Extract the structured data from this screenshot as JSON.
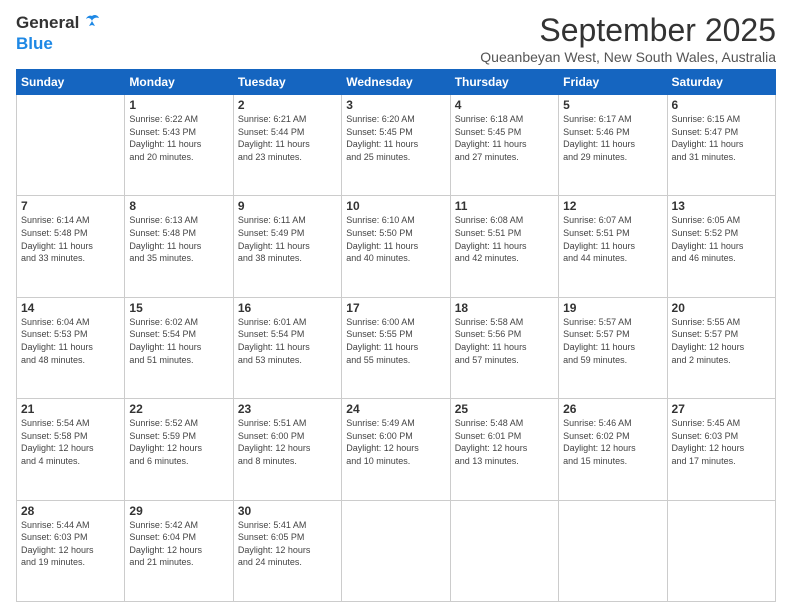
{
  "header": {
    "logo": {
      "general": "General",
      "blue": "Blue"
    },
    "title": "September 2025",
    "subtitle": "Queanbeyan West, New South Wales, Australia"
  },
  "days_of_week": [
    "Sunday",
    "Monday",
    "Tuesday",
    "Wednesday",
    "Thursday",
    "Friday",
    "Saturday"
  ],
  "weeks": [
    [
      {
        "day": "",
        "info": ""
      },
      {
        "day": "1",
        "info": "Sunrise: 6:22 AM\nSunset: 5:43 PM\nDaylight: 11 hours\nand 20 minutes."
      },
      {
        "day": "2",
        "info": "Sunrise: 6:21 AM\nSunset: 5:44 PM\nDaylight: 11 hours\nand 23 minutes."
      },
      {
        "day": "3",
        "info": "Sunrise: 6:20 AM\nSunset: 5:45 PM\nDaylight: 11 hours\nand 25 minutes."
      },
      {
        "day": "4",
        "info": "Sunrise: 6:18 AM\nSunset: 5:45 PM\nDaylight: 11 hours\nand 27 minutes."
      },
      {
        "day": "5",
        "info": "Sunrise: 6:17 AM\nSunset: 5:46 PM\nDaylight: 11 hours\nand 29 minutes."
      },
      {
        "day": "6",
        "info": "Sunrise: 6:15 AM\nSunset: 5:47 PM\nDaylight: 11 hours\nand 31 minutes."
      }
    ],
    [
      {
        "day": "7",
        "info": "Sunrise: 6:14 AM\nSunset: 5:48 PM\nDaylight: 11 hours\nand 33 minutes."
      },
      {
        "day": "8",
        "info": "Sunrise: 6:13 AM\nSunset: 5:48 PM\nDaylight: 11 hours\nand 35 minutes."
      },
      {
        "day": "9",
        "info": "Sunrise: 6:11 AM\nSunset: 5:49 PM\nDaylight: 11 hours\nand 38 minutes."
      },
      {
        "day": "10",
        "info": "Sunrise: 6:10 AM\nSunset: 5:50 PM\nDaylight: 11 hours\nand 40 minutes."
      },
      {
        "day": "11",
        "info": "Sunrise: 6:08 AM\nSunset: 5:51 PM\nDaylight: 11 hours\nand 42 minutes."
      },
      {
        "day": "12",
        "info": "Sunrise: 6:07 AM\nSunset: 5:51 PM\nDaylight: 11 hours\nand 44 minutes."
      },
      {
        "day": "13",
        "info": "Sunrise: 6:05 AM\nSunset: 5:52 PM\nDaylight: 11 hours\nand 46 minutes."
      }
    ],
    [
      {
        "day": "14",
        "info": "Sunrise: 6:04 AM\nSunset: 5:53 PM\nDaylight: 11 hours\nand 48 minutes."
      },
      {
        "day": "15",
        "info": "Sunrise: 6:02 AM\nSunset: 5:54 PM\nDaylight: 11 hours\nand 51 minutes."
      },
      {
        "day": "16",
        "info": "Sunrise: 6:01 AM\nSunset: 5:54 PM\nDaylight: 11 hours\nand 53 minutes."
      },
      {
        "day": "17",
        "info": "Sunrise: 6:00 AM\nSunset: 5:55 PM\nDaylight: 11 hours\nand 55 minutes."
      },
      {
        "day": "18",
        "info": "Sunrise: 5:58 AM\nSunset: 5:56 PM\nDaylight: 11 hours\nand 57 minutes."
      },
      {
        "day": "19",
        "info": "Sunrise: 5:57 AM\nSunset: 5:57 PM\nDaylight: 11 hours\nand 59 minutes."
      },
      {
        "day": "20",
        "info": "Sunrise: 5:55 AM\nSunset: 5:57 PM\nDaylight: 12 hours\nand 2 minutes."
      }
    ],
    [
      {
        "day": "21",
        "info": "Sunrise: 5:54 AM\nSunset: 5:58 PM\nDaylight: 12 hours\nand 4 minutes."
      },
      {
        "day": "22",
        "info": "Sunrise: 5:52 AM\nSunset: 5:59 PM\nDaylight: 12 hours\nand 6 minutes."
      },
      {
        "day": "23",
        "info": "Sunrise: 5:51 AM\nSunset: 6:00 PM\nDaylight: 12 hours\nand 8 minutes."
      },
      {
        "day": "24",
        "info": "Sunrise: 5:49 AM\nSunset: 6:00 PM\nDaylight: 12 hours\nand 10 minutes."
      },
      {
        "day": "25",
        "info": "Sunrise: 5:48 AM\nSunset: 6:01 PM\nDaylight: 12 hours\nand 13 minutes."
      },
      {
        "day": "26",
        "info": "Sunrise: 5:46 AM\nSunset: 6:02 PM\nDaylight: 12 hours\nand 15 minutes."
      },
      {
        "day": "27",
        "info": "Sunrise: 5:45 AM\nSunset: 6:03 PM\nDaylight: 12 hours\nand 17 minutes."
      }
    ],
    [
      {
        "day": "28",
        "info": "Sunrise: 5:44 AM\nSunset: 6:03 PM\nDaylight: 12 hours\nand 19 minutes."
      },
      {
        "day": "29",
        "info": "Sunrise: 5:42 AM\nSunset: 6:04 PM\nDaylight: 12 hours\nand 21 minutes."
      },
      {
        "day": "30",
        "info": "Sunrise: 5:41 AM\nSunset: 6:05 PM\nDaylight: 12 hours\nand 24 minutes."
      },
      {
        "day": "",
        "info": ""
      },
      {
        "day": "",
        "info": ""
      },
      {
        "day": "",
        "info": ""
      },
      {
        "day": "",
        "info": ""
      }
    ]
  ]
}
